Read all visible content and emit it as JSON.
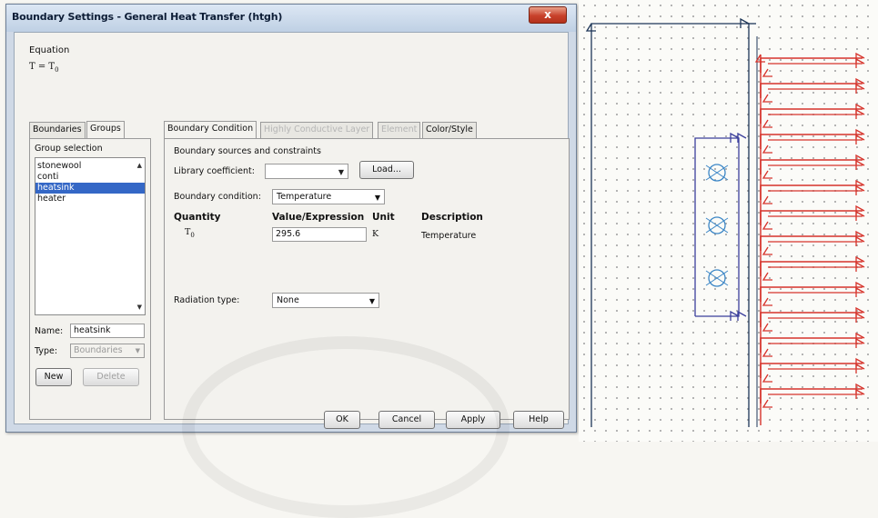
{
  "dialog": {
    "title": "Boundary Settings - General Heat Transfer (htgh)",
    "close_glyph": "x",
    "equation_label": "Equation",
    "equation_lhs": "T = T",
    "equation_sub": "0"
  },
  "left_tabs": [
    "Boundaries",
    "Groups"
  ],
  "groups": {
    "selection_label": "Group selection",
    "items": [
      "stonewool",
      "conti",
      "heatsink",
      "heater"
    ],
    "selected_index": 2,
    "name_label": "Name:",
    "name_value": "heatsink",
    "type_label": "Type:",
    "type_value": "Boundaries",
    "new_button": "New",
    "delete_button": "Delete"
  },
  "right_tabs": [
    "Boundary Condition",
    "Highly Conductive Layer",
    "Element",
    "Color/Style"
  ],
  "boundary": {
    "section_title": "Boundary sources and constraints",
    "library_label": "Library coefficient:",
    "library_value": "",
    "load_button": "Load...",
    "condition_label": "Boundary condition:",
    "condition_value": "Temperature",
    "col_quantity": "Quantity",
    "col_value": "Value/Expression",
    "col_unit": "Unit",
    "col_description": "Description",
    "row_quantity": "T",
    "row_quantity_sub": "0",
    "row_value": "295.6",
    "row_unit": "K",
    "row_description": "Temperature",
    "radiation_label": "Radiation type:",
    "radiation_value": "None"
  },
  "footer": {
    "ok": "OK",
    "cancel": "Cancel",
    "apply": "Apply",
    "help": "Help"
  },
  "diagram": {
    "outer_color": "#1d3557",
    "inner_color": "#3b3f9c",
    "heat_color": "#d6332b",
    "circle_color": "#3b86c6",
    "heater_circles": 3,
    "heat_flow_arrows": 14
  }
}
